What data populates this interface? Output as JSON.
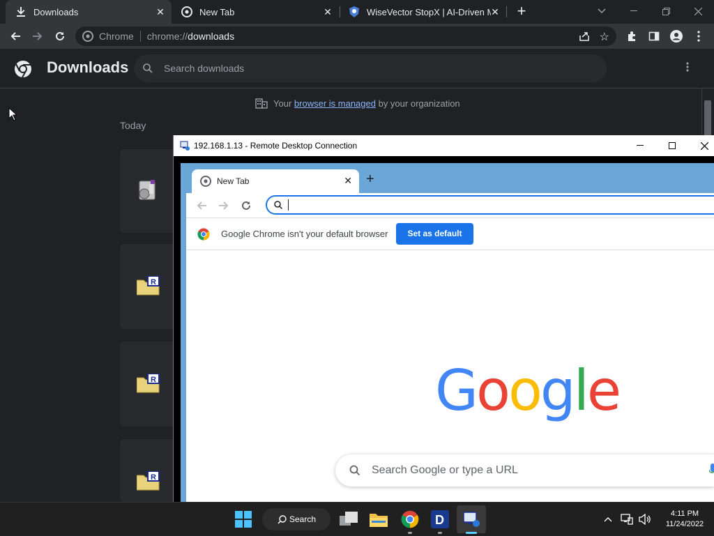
{
  "browser": {
    "tabs": [
      {
        "label": "Downloads",
        "icon": "download-icon"
      },
      {
        "label": "New Tab",
        "icon": "chrome-icon"
      },
      {
        "label": "WiseVector StopX | AI-Driven Ma",
        "icon": "wisevector-icon"
      }
    ],
    "omnibox": {
      "chip": "Chrome",
      "url_scheme": "chrome://",
      "url_host": "downloads"
    }
  },
  "downloads_page": {
    "title": "Downloads",
    "search_placeholder": "Search downloads",
    "managed_prefix": "Your",
    "managed_link": "browser is managed",
    "managed_suffix": "by your organization",
    "section_label": "Today"
  },
  "rdp": {
    "title": "192.168.1.13 - Remote Desktop Connection",
    "inner_tab": "New Tab",
    "default_browser_text": "Google Chrome isn't your default browser",
    "set_default_button": "Set as default",
    "google_search_placeholder": "Search Google or type a URL",
    "google_letters": [
      "G",
      "o",
      "o",
      "g",
      "l",
      "e"
    ]
  },
  "taskbar": {
    "search_label": "Search",
    "time": "4:11 PM",
    "date": "11/24/2022"
  },
  "colors": {
    "google_blue": "#4285F4",
    "google_red": "#EA4335",
    "google_yellow": "#FBBC05",
    "google_green": "#34A853",
    "accent": "#1a73e8"
  }
}
